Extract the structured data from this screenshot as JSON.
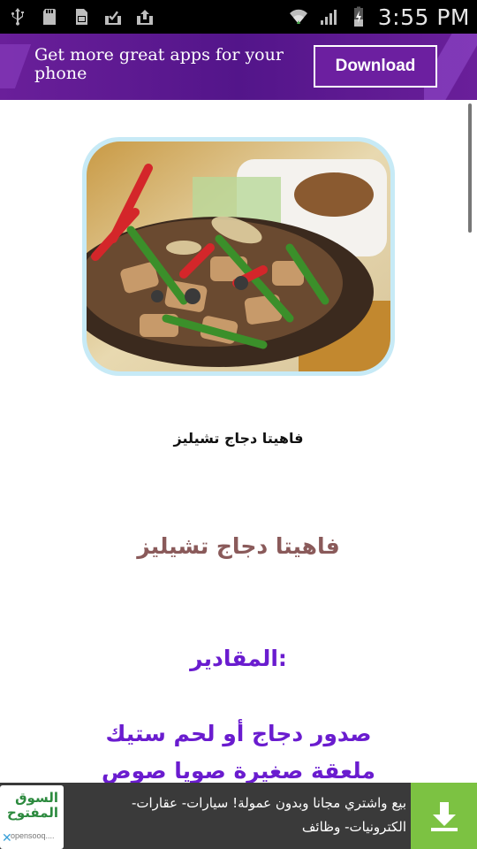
{
  "status_bar": {
    "time": "3:55 PM",
    "left_icons": [
      "usb-icon",
      "sd-card-icon",
      "sim-icon",
      "download-done-icon",
      "upload-done-icon"
    ],
    "right_icons": [
      "wifi-icon",
      "signal-icon",
      "battery-charging-icon"
    ]
  },
  "promo": {
    "text": "Get more great apps for your phone",
    "button_label": "Download",
    "colors": {
      "background": "#5a178f",
      "button_border": "#ffffff"
    }
  },
  "article": {
    "image_icon": "food-image",
    "caption": "فاهيتا دجاج تشيليز",
    "title": "فاهيتا دجاج تشيليز",
    "ingredients_heading": ":المقادير",
    "ingredients": [
      "صدور دجاج أو لحم ستيك",
      "ملعقة صغيرة صويا صوص"
    ],
    "colors": {
      "title": "#8a5a5a",
      "ingredients": "#6a1ccf"
    }
  },
  "ad": {
    "logo_text": "السوق المفتوح",
    "logo_subtext": "opensooq....",
    "text": "بيع واشتري مجانا وبدون عمولة! سيارات- عقارات- الكترونيات- وظائف",
    "close_icon": "close-icon",
    "download_icon": "download-icon",
    "colors": {
      "background": "#3a3a3a",
      "download_bg": "#7cc242"
    }
  }
}
